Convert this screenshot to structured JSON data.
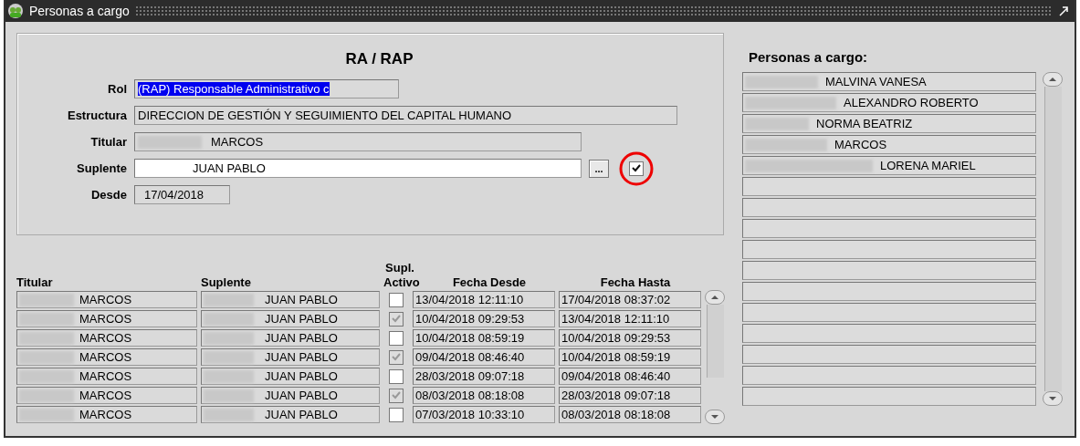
{
  "window": {
    "title": "Personas a cargo"
  },
  "form": {
    "heading": "RA / RAP",
    "fields": [
      {
        "label": "Rol",
        "value": "(RAP) Responsable Administrativo c",
        "kind": "selected"
      },
      {
        "label": "Estructura",
        "value": "DIRECCION DE GESTIÓN Y SEGUIMIENTO DEL CAPITAL HUMANO",
        "kind": "readonly"
      },
      {
        "label": "Titular",
        "value": "MARCOS",
        "kind": "readonly"
      },
      {
        "label": "Suplente",
        "value": "JUAN PABLO",
        "kind": "editable",
        "lookup_button": "...",
        "checked": true
      },
      {
        "label": "Desde",
        "value": "17/04/2018",
        "kind": "short"
      }
    ]
  },
  "table": {
    "columns": [
      "Titular",
      "Suplente",
      "Supl. Activo",
      "Fecha Desde",
      "Fecha Hasta"
    ],
    "rows": [
      {
        "titular": "MARCOS",
        "suplente": "JUAN PABLO",
        "checked": false,
        "desde": "13/04/2018 12:11:10",
        "hasta": "17/04/2018 08:37:02"
      },
      {
        "titular": "MARCOS",
        "suplente": "JUAN PABLO",
        "checked": true,
        "desde": "10/04/2018 09:29:53",
        "hasta": "13/04/2018 12:11:10"
      },
      {
        "titular": "MARCOS",
        "suplente": "JUAN PABLO",
        "checked": false,
        "desde": "10/04/2018 08:59:19",
        "hasta": "10/04/2018 09:29:53"
      },
      {
        "titular": "MARCOS",
        "suplente": "JUAN PABLO",
        "checked": true,
        "desde": "09/04/2018 08:46:40",
        "hasta": "10/04/2018 08:59:19"
      },
      {
        "titular": "MARCOS",
        "suplente": "JUAN PABLO",
        "checked": false,
        "desde": "28/03/2018 09:07:18",
        "hasta": "09/04/2018 08:46:40"
      },
      {
        "titular": "MARCOS",
        "suplente": "JUAN PABLO",
        "checked": true,
        "desde": "08/03/2018 08:18:08",
        "hasta": "28/03/2018 09:07:18"
      },
      {
        "titular": "MARCOS",
        "suplente": "JUAN PABLO",
        "checked": false,
        "desde": "07/03/2018 10:33:10",
        "hasta": "08/03/2018 08:18:08"
      }
    ]
  },
  "personas": {
    "title": "Personas a cargo:",
    "items": [
      "MALVINA VANESA",
      "ALEXANDRO ROBERTO",
      "NORMA BEATRIZ",
      "MARCOS",
      "LORENA MARIEL"
    ]
  }
}
